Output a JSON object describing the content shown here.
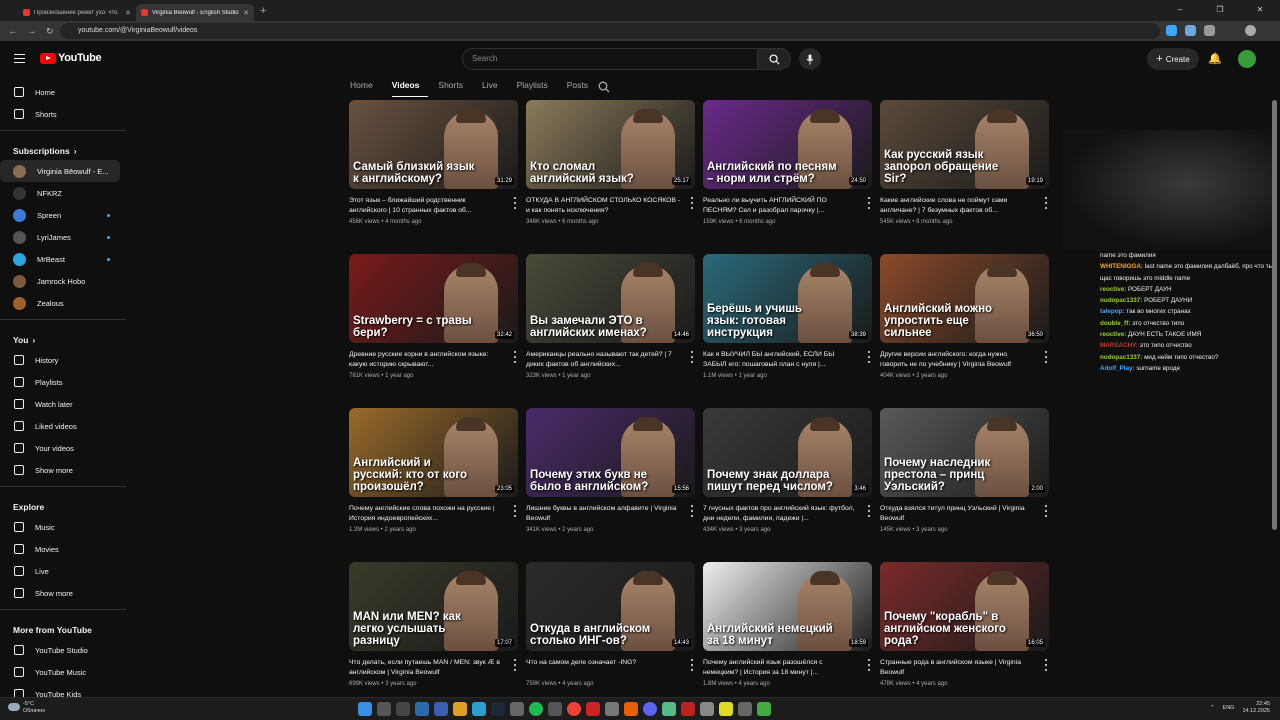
{
  "browser": {
    "tabs": [
      {
        "title": "Произношение режет ухо: что",
        "active": false
      },
      {
        "title": "Virginia Bēowulf - English Studio",
        "active": true
      }
    ],
    "url": "youtube.com/@VirginiaBeowulf/videos"
  },
  "header": {
    "logo": "YouTube",
    "search_placeholder": "Search",
    "create_label": "Create"
  },
  "sidebar": {
    "main": [
      {
        "label": "Home",
        "icon": "home-icon"
      },
      {
        "label": "Shorts",
        "icon": "shorts-icon"
      }
    ],
    "subscriptions_title": "Subscriptions",
    "subscriptions": [
      {
        "label": "Virginia Bēowulf - E...",
        "color": "#8a6d55",
        "selected": true,
        "live": false
      },
      {
        "label": "NFKRZ",
        "color": "#333",
        "selected": false,
        "live": false
      },
      {
        "label": "Spreen",
        "color": "#3a7bd5",
        "selected": false,
        "live": true
      },
      {
        "label": "LyriJames",
        "color": "#555",
        "selected": false,
        "live": true
      },
      {
        "label": "MrBeast",
        "color": "#2aa7e0",
        "selected": false,
        "live": true
      },
      {
        "label": "Jamrock Hobo",
        "color": "#7a5a3a",
        "selected": false,
        "live": false
      },
      {
        "label": "Zealous",
        "color": "#a0602a",
        "selected": false,
        "live": false
      }
    ],
    "you_title": "You",
    "you": [
      {
        "label": "History",
        "icon": "history-icon"
      },
      {
        "label": "Playlists",
        "icon": "playlists-icon"
      },
      {
        "label": "Watch later",
        "icon": "watch-later-icon"
      },
      {
        "label": "Liked videos",
        "icon": "liked-icon"
      },
      {
        "label": "Your videos",
        "icon": "your-videos-icon"
      },
      {
        "label": "Show more",
        "icon": "chevron-down-icon"
      }
    ],
    "explore_title": "Explore",
    "explore": [
      {
        "label": "Music",
        "icon": "music-icon"
      },
      {
        "label": "Movies",
        "icon": "movies-icon"
      },
      {
        "label": "Live",
        "icon": "live-icon"
      },
      {
        "label": "Show more",
        "icon": "chevron-down-icon"
      }
    ],
    "more_title": "More from YouTube",
    "more": [
      {
        "label": "YouTube Studio",
        "icon": "studio-icon"
      },
      {
        "label": "YouTube Music",
        "icon": "yt-music-icon"
      },
      {
        "label": "YouTube Kids",
        "icon": "yt-kids-icon"
      }
    ]
  },
  "channel_tabs": [
    {
      "label": "Home",
      "active": false
    },
    {
      "label": "Videos",
      "active": true
    },
    {
      "label": "Shorts",
      "active": false
    },
    {
      "label": "Live",
      "active": false
    },
    {
      "label": "Playlists",
      "active": false
    },
    {
      "label": "Posts",
      "active": false
    }
  ],
  "videos": [
    {
      "caption": "Самый близкий язык к английскому?",
      "duration": "31:29",
      "title": "Этот язык – ближайший родственник английского | 10 странных фактов об...",
      "views": "456K views",
      "age": "4 months ago",
      "bg": "#6a5240"
    },
    {
      "caption": "Кто сломал английский язык?",
      "duration": "25:17",
      "title": "ОТКУДА В АНГЛИЙСКОМ СТОЛЬКО КОСЯКОВ - и как понять исключения?",
      "views": "348K views",
      "age": "6 months ago",
      "bg": "#8a7a5a"
    },
    {
      "caption": "Английский по песням – норм или стрём?",
      "duration": "24:50",
      "title": "Реально ли выучить АНГЛИЙСКИЙ ПО ПЕСНЯМ? Сел и разобрал парочку |...",
      "views": "159K views",
      "age": "6 months ago",
      "bg": "#6a2a8a"
    },
    {
      "caption": "Как русский язык запорол обращение Sir?",
      "duration": "19:19",
      "title": "Какие английские слова не поймут сами англичане? | 7 безумных фактов об...",
      "views": "545K views",
      "age": "8 months ago",
      "bg": "#5a4a3a"
    },
    {
      "caption": "Strawberry = с травы бери?",
      "duration": "32:42",
      "title": "Древние русские корни в английском языке: какую историю скрывают...",
      "views": "781K views",
      "age": "1 year ago",
      "bg": "#7a1a1a"
    },
    {
      "caption": "Вы замечали ЭТО в английских именах?",
      "duration": "14:46",
      "title": "Американцы реально называют так детей? | 7 диких фактов об английских...",
      "views": "323K views",
      "age": "1 year ago",
      "bg": "#4a4a3a"
    },
    {
      "caption": "Берёшь и учишь язык: готовая инструкция",
      "duration": "38:39",
      "title": "Как я ВЫУЧИЛ БЫ английский, ЕСЛИ БЫ ЗАБЫЛ его: пошаговый план с нуля |...",
      "views": "1.1M views",
      "age": "1 year ago",
      "bg": "#2a6a7a"
    },
    {
      "caption": "Английский можно упростить еще сильнее",
      "duration": "36:50",
      "title": "Другие версии английского: когда нужно говорить не по учебнику | Virginia Beowulf",
      "views": "404K views",
      "age": "2 years ago",
      "bg": "#8a4a2a"
    },
    {
      "caption": "Английский и русский: кто от кого произошёл?",
      "duration": "23:05",
      "title": "Почему английские слова похожи на русские | История индоевропейских...",
      "views": "1.3M views",
      "age": "2 years ago",
      "bg": "#9a6a2a"
    },
    {
      "caption": "Почему этих букв не было в английском?",
      "duration": "15:56",
      "title": "Лишние буквы в английском алфавите | Virginia Beowulf",
      "views": "341K views",
      "age": "2 years ago",
      "bg": "#4a2a6a"
    },
    {
      "caption": "Почему знак доллара пишут перед числом?",
      "duration": "3:46",
      "title": "7 гнусных фактов про английский язык: футбол, дни недели, фамилии, падежи |...",
      "views": "434K views",
      "age": "3 years ago",
      "bg": "#3a3a3a"
    },
    {
      "caption": "Почему наследник престола – принц Уэльский?",
      "duration": "2:00",
      "title": "Откуда взялся титул принц Уэльский | Virginia Beowulf",
      "views": "145K views",
      "age": "3 years ago",
      "bg": "#5a5a5a"
    },
    {
      "caption": "MAN или MEN? как легко услышать разницу",
      "duration": "17:07",
      "title": "Что делать, если путаешь MAN / MEN: звук Æ в английском | Virginia Beowulf",
      "views": "699K views",
      "age": "3 years ago",
      "bg": "#3a3a2a"
    },
    {
      "caption": "Откуда в английском столько ИНГ-ов?",
      "duration": "14:43",
      "title": "Что на самом деле означает -ING?",
      "views": "759K views",
      "age": "4 years ago",
      "bg": "#2a2a2a"
    },
    {
      "caption": "Английский немецкий за 18 минут",
      "duration": "18:59",
      "title": "Почему английский язык разошёлся с немецким? | История за 18 минут |...",
      "views": "1.8M views",
      "age": "4 years ago",
      "bg": "#eeeeee"
    },
    {
      "caption": "Почему \"корабль\" в английском женского рода?",
      "duration": "16:05",
      "title": "Странные рода в английском языке | Virginia Beowulf",
      "views": "478K views",
      "age": "4 years ago",
      "bg": "#7a2a2a"
    }
  ],
  "chat": [
    {
      "user": "",
      "text": "name это фамилия",
      "color": "#eee"
    },
    {
      "user": "WHITENIGGA:",
      "text": "last name это фамилия далбаёб, про что ты щас говоришь это middle name",
      "color": "#f5a623"
    },
    {
      "user": "reoctive:",
      "text": "РОБЕРТ ДАУН",
      "color": "#9acd32"
    },
    {
      "user": "nudopac1337:",
      "text": "РОБЕРТ ДАУНИ",
      "color": "#9acd32"
    },
    {
      "user": "talepop:",
      "text": "так во многих странах",
      "color": "#3ea6ff"
    },
    {
      "user": "double_ff:",
      "text": "это отчество типо",
      "color": "#9acd32"
    },
    {
      "user": "reoctive:",
      "text": "ДАУН ЕСТЬ ТАКОЕ ИМЯ",
      "color": "#9acd32"
    },
    {
      "user": "MARSACHY:",
      "text": "это типо отчество",
      "color": "#c0392b"
    },
    {
      "user": "nudopac1337:",
      "text": "мид нейм типо отчество?",
      "color": "#9acd32"
    },
    {
      "user": "Adolf_Play:",
      "text": "surname вроде",
      "color": "#3ea6ff"
    }
  ],
  "taskbar": {
    "weather_temp": "-5°C",
    "weather_desc": "Облачно",
    "lang": "ENG",
    "time": "22:45",
    "date": "14.12.2025"
  }
}
